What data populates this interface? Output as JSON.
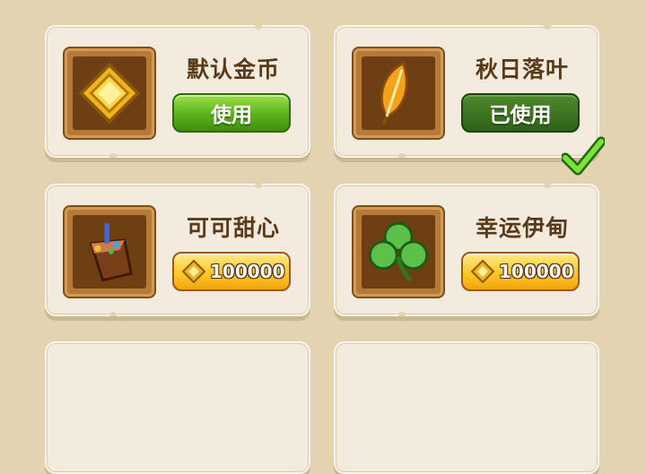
{
  "items": [
    {
      "name": "默认金币",
      "button": "使用",
      "state": "use",
      "icon": "gold-coin-icon"
    },
    {
      "name": "秋日落叶",
      "button": "已使用",
      "state": "used",
      "icon": "autumn-leaf-icon"
    },
    {
      "name": "可可甜心",
      "button": "100000",
      "state": "price",
      "icon": "cocoa-cake-icon"
    },
    {
      "name": "幸运伊甸",
      "button": "100000",
      "state": "price",
      "icon": "clover-icon"
    }
  ],
  "colors": {
    "green_button": "#5ab31a",
    "used_button": "#2f6218",
    "price_button": "#ffc928",
    "card": "#f3ecde",
    "background": "#e3d3b0"
  }
}
